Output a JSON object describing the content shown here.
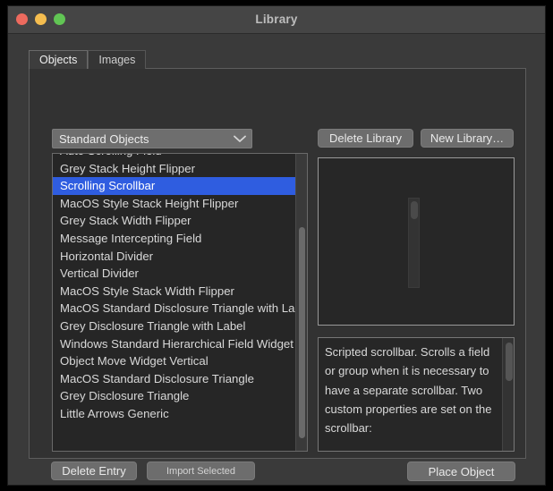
{
  "window": {
    "title": "Library",
    "traffic_lights": [
      {
        "name": "close-button",
        "color": "#ed6a5e"
      },
      {
        "name": "minimize-button",
        "color": "#f5bd4f"
      },
      {
        "name": "zoom-button",
        "color": "#61c554"
      }
    ]
  },
  "tabs": [
    {
      "label": "Objects",
      "active": true
    },
    {
      "label": "Images",
      "active": false
    }
  ],
  "library_select": {
    "value": "Standard Objects",
    "icon": "chevron-down-icon"
  },
  "header_buttons": {
    "delete_library": "Delete Library",
    "new_library": "New Library…"
  },
  "object_list": {
    "items": [
      {
        "label": "Auto Scrolling Field",
        "selected": false
      },
      {
        "label": "Grey Stack Height Flipper",
        "selected": false
      },
      {
        "label": "Scrolling Scrollbar",
        "selected": true
      },
      {
        "label": "MacOS Style Stack Height Flipper",
        "selected": false
      },
      {
        "label": "Grey Stack Width Flipper",
        "selected": false
      },
      {
        "label": "Message Intercepting Field",
        "selected": false
      },
      {
        "label": "Horizontal Divider",
        "selected": false
      },
      {
        "label": "Vertical Divider",
        "selected": false
      },
      {
        "label": "MacOS Style Stack Width Flipper",
        "selected": false
      },
      {
        "label": "MacOS Standard Disclosure Triangle with Label",
        "selected": false
      },
      {
        "label": "Grey Disclosure Triangle with Label",
        "selected": false
      },
      {
        "label": "Windows Standard Hierarchical Field Widget",
        "selected": false
      },
      {
        "label": "Object Move Widget Vertical",
        "selected": false
      },
      {
        "label": "MacOS Standard Disclosure Triangle",
        "selected": false
      },
      {
        "label": "Grey Disclosure Triangle",
        "selected": false
      },
      {
        "label": "Little Arrows Generic",
        "selected": false
      }
    ],
    "selection_color": "#2f5de0"
  },
  "preview": {
    "widget_name": "vertical-scrollbar-preview"
  },
  "description": {
    "text": "Scripted scrollbar. Scrolls a field or group when it is necessary to have a separate scrollbar. Two custom properties are set on the scrollbar:"
  },
  "footer_buttons": {
    "delete_entry": "Delete Entry",
    "import_selected": "Import Selected",
    "place_object": "Place Object"
  }
}
